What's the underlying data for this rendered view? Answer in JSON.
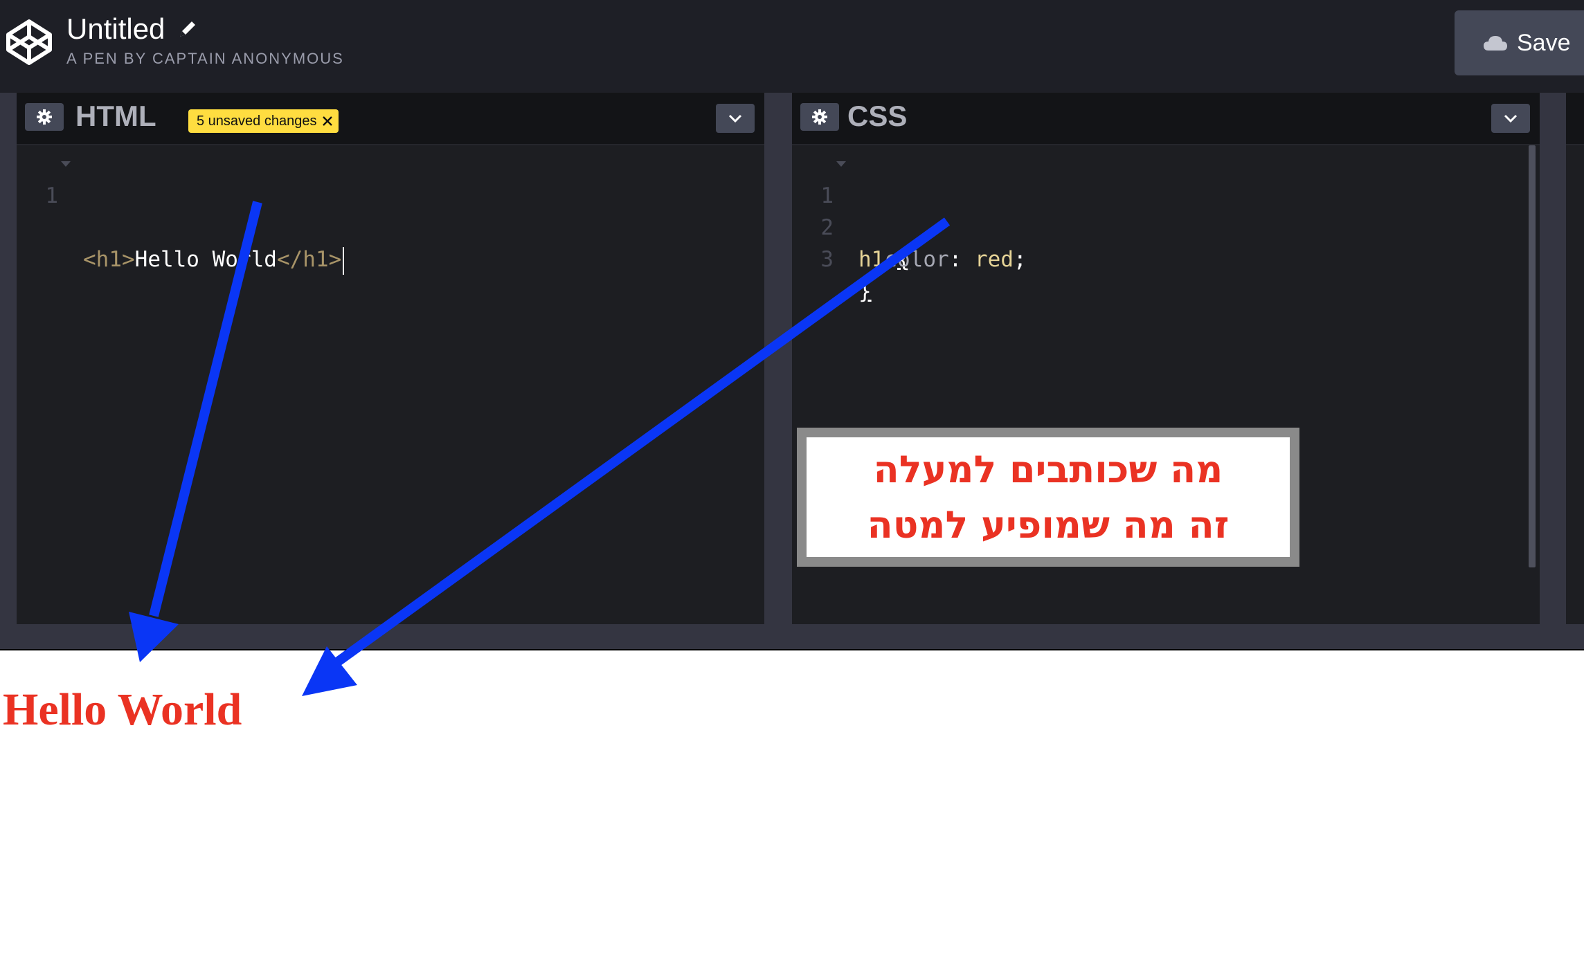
{
  "header": {
    "title": "Untitled",
    "subtitle": "A PEN BY CAPTAIN ANONYMOUS",
    "save_label": "Save"
  },
  "editors": {
    "html": {
      "title": "HTML",
      "badge": "5 unsaved changes",
      "lines": [
        {
          "num": "1",
          "open": "<h1>",
          "text": "Hello World",
          "close": "</h1>"
        }
      ]
    },
    "css": {
      "title": "CSS",
      "line1": {
        "num": "1",
        "selector": "h1",
        "brace": "{"
      },
      "line2": {
        "num": "2",
        "prop": "color",
        "colon": ":",
        "value": "red",
        "semi": ";"
      },
      "line3": {
        "num": "3",
        "brace": "}"
      }
    }
  },
  "preview": {
    "heading": "Hello World"
  },
  "annotation": {
    "line1": "מה שכותבים למעלה",
    "line2": "זה מה שמופיע למטה"
  },
  "colors": {
    "header_bg": "#1e1f26",
    "editor_bg": "#1d1e22",
    "badge": "#ffdd40",
    "preview_text": "#ea3223",
    "arrow": "#0a36f5"
  },
  "icons": [
    "codepen-logo-icon",
    "pencil-icon",
    "cloud-icon",
    "gear-icon",
    "close-icon",
    "chevron-down-icon"
  ]
}
